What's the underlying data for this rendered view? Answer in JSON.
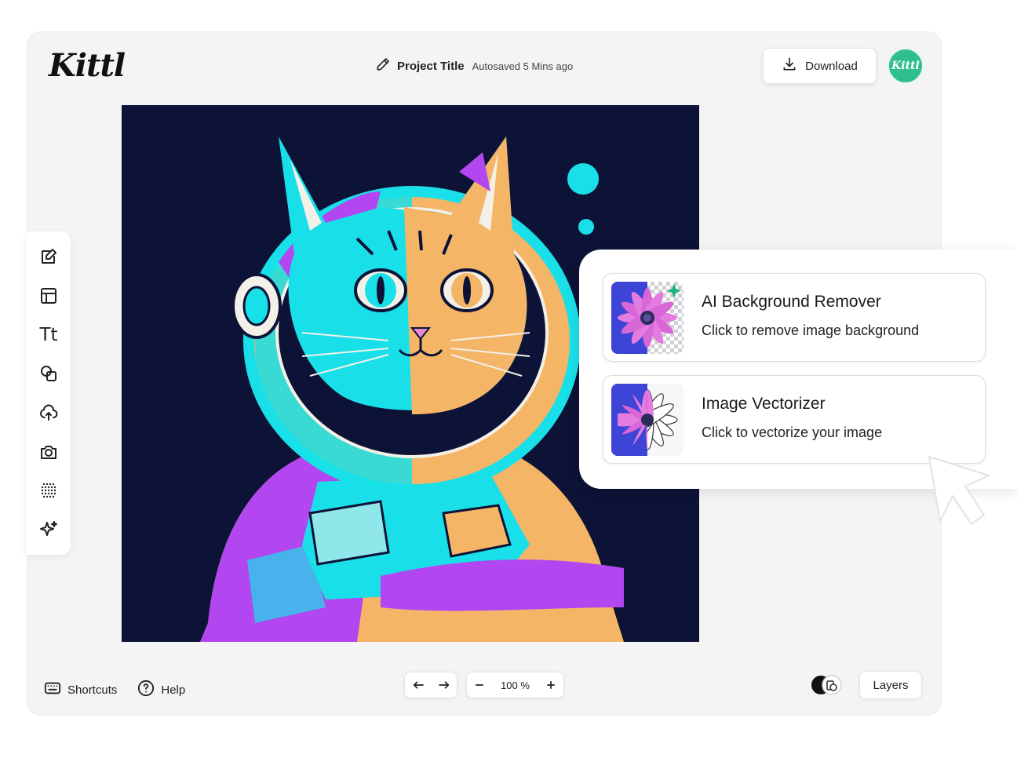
{
  "app": {
    "logo": "Kittl"
  },
  "header": {
    "project_title": "Project Title",
    "autosave_status": "Autosaved 5 Mins ago",
    "download_label": "Download",
    "avatar_text": "Kittl",
    "avatar_color": "#2fbf8f"
  },
  "toolbar": {
    "tools": [
      {
        "icon": "edit-icon"
      },
      {
        "icon": "templates-icon"
      },
      {
        "icon": "text-icon",
        "glyph": "Tt"
      },
      {
        "icon": "shapes-icon"
      },
      {
        "icon": "upload-icon"
      },
      {
        "icon": "camera-icon"
      },
      {
        "icon": "pattern-icon"
      },
      {
        "icon": "ai-sparkle-icon"
      }
    ]
  },
  "canvas": {
    "background": "#0d1237",
    "artwork": "astronaut-cat-illustration",
    "colors": {
      "cyan": "#19e0e8",
      "orange": "#f5b566",
      "purple": "#b246f0",
      "white": "#f3f0e8"
    }
  },
  "ai_tools": {
    "cards": [
      {
        "title": "AI Background Remover",
        "subtitle": "Click to remove image background",
        "icon": "background-remover-icon"
      },
      {
        "title": "Image Vectorizer",
        "subtitle": "Click to vectorize your image",
        "icon": "vectorizer-icon"
      }
    ]
  },
  "footer": {
    "shortcuts_label": "Shortcuts",
    "help_label": "Help",
    "zoom": "100 %",
    "zoom_percent": 100,
    "layers_label": "Layers"
  }
}
